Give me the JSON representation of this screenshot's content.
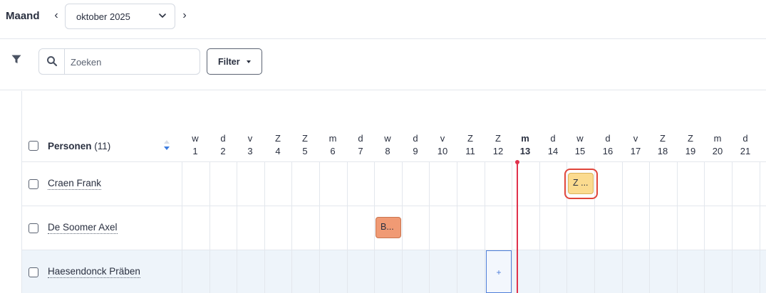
{
  "topbar": {
    "view_label": "Maand",
    "prev_label": "‹",
    "next_label": "›",
    "month_value": "oktober 2025"
  },
  "toolbar": {
    "search_placeholder": "Zoeken",
    "filter_label": "Filter"
  },
  "grid": {
    "persons_label": "Personen",
    "persons_count": "(11)",
    "days": [
      {
        "wd": "w",
        "d": "1"
      },
      {
        "wd": "d",
        "d": "2"
      },
      {
        "wd": "v",
        "d": "3"
      },
      {
        "wd": "Z",
        "d": "4"
      },
      {
        "wd": "Z",
        "d": "5"
      },
      {
        "wd": "m",
        "d": "6"
      },
      {
        "wd": "d",
        "d": "7"
      },
      {
        "wd": "w",
        "d": "8"
      },
      {
        "wd": "d",
        "d": "9"
      },
      {
        "wd": "v",
        "d": "10"
      },
      {
        "wd": "Z",
        "d": "11"
      },
      {
        "wd": "Z",
        "d": "12"
      },
      {
        "wd": "m",
        "d": "13",
        "today": true
      },
      {
        "wd": "d",
        "d": "14"
      },
      {
        "wd": "w",
        "d": "15"
      },
      {
        "wd": "d",
        "d": "16"
      },
      {
        "wd": "v",
        "d": "17"
      },
      {
        "wd": "Z",
        "d": "18"
      },
      {
        "wd": "Z",
        "d": "19"
      },
      {
        "wd": "m",
        "d": "20"
      },
      {
        "wd": "d",
        "d": "21"
      }
    ],
    "rows": [
      {
        "name": "Craen Frank",
        "events": [
          {
            "day": 15,
            "label": "Z ...",
            "color": "yellow",
            "highlighted": true
          }
        ]
      },
      {
        "name": "De Soomer Axel",
        "events": [
          {
            "day": 8,
            "label": "B...",
            "color": "orange"
          }
        ]
      },
      {
        "name": "Haesendonck Präben",
        "events": [],
        "add_day": 12,
        "add_label": "+"
      }
    ]
  },
  "colors": {
    "today_marker": "#e0314b",
    "event_yellow": "#fbdb8f",
    "event_orange": "#f09a74",
    "add_cell_border": "#4e7fd9",
    "highlight_ring": "#e0453a"
  }
}
